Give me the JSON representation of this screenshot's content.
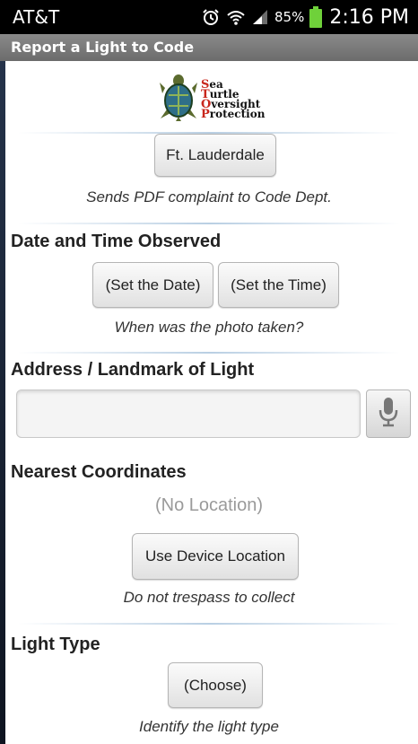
{
  "status_bar": {
    "carrier": "AT&T",
    "battery_percent": "85%",
    "time": "2:16 PM",
    "icons": [
      "alarm-icon",
      "wifi-icon",
      "signal-icon",
      "battery-icon"
    ]
  },
  "app_bar": {
    "title": "Report a Light to Code"
  },
  "logo": {
    "words": [
      "Sea",
      "Turtle",
      "Oversight",
      "Protection"
    ]
  },
  "city": {
    "button_label": "Ft. Lauderdale",
    "hint": "Sends PDF complaint to Code Dept."
  },
  "date_time": {
    "heading": "Date and Time Observed",
    "set_date_label": "(Set the Date)",
    "set_time_label": "(Set the Time)",
    "hint": "When was the photo taken?"
  },
  "address": {
    "heading": "Address / Landmark of Light",
    "value": "",
    "placeholder": ""
  },
  "coordinates": {
    "heading": "Nearest Coordinates",
    "value": "(No Location)",
    "button_label": "Use Device Location",
    "hint": "Do not trespass to collect"
  },
  "light_type": {
    "heading": "Light Type",
    "button_label": "(Choose)",
    "hint": "Identify the light type"
  },
  "colors": {
    "status_bar": "#000000",
    "app_bar": "#7a7a7a",
    "background": "#ffffff",
    "divider": "#b9cfe3"
  }
}
